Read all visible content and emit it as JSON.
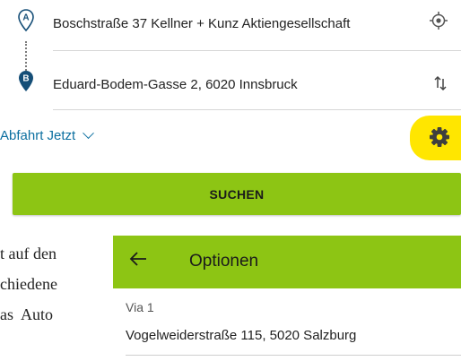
{
  "route": {
    "from": {
      "marker": "A",
      "value": "Boschstraße 37 Kellner + Kunz Aktiengesellschaft"
    },
    "to": {
      "marker": "B",
      "value": "Eduard-Bodem-Gasse 2, 6020 Innsbruck"
    }
  },
  "departure": {
    "label": "Abfahrt",
    "value": "Jetzt"
  },
  "search_button": "SUCHEN",
  "document_text": {
    "line1": "t auf den",
    "line2": "chiedene",
    "line3": "as  Auto"
  },
  "options_panel": {
    "title": "Optionen",
    "via_label": "Via 1",
    "via_value": "Vogelweiderstraße 115, 5020 Salzburg"
  },
  "colors": {
    "accent_green": "#8dc514",
    "link_blue": "#0b6fa0",
    "pin_dark": "#154e77",
    "highlight": "#ffe600"
  },
  "icons": [
    "marker-a-icon",
    "marker-b-icon",
    "locate-icon",
    "swap-icon",
    "chevron-down-icon",
    "gear-icon",
    "back-arrow-icon"
  ]
}
